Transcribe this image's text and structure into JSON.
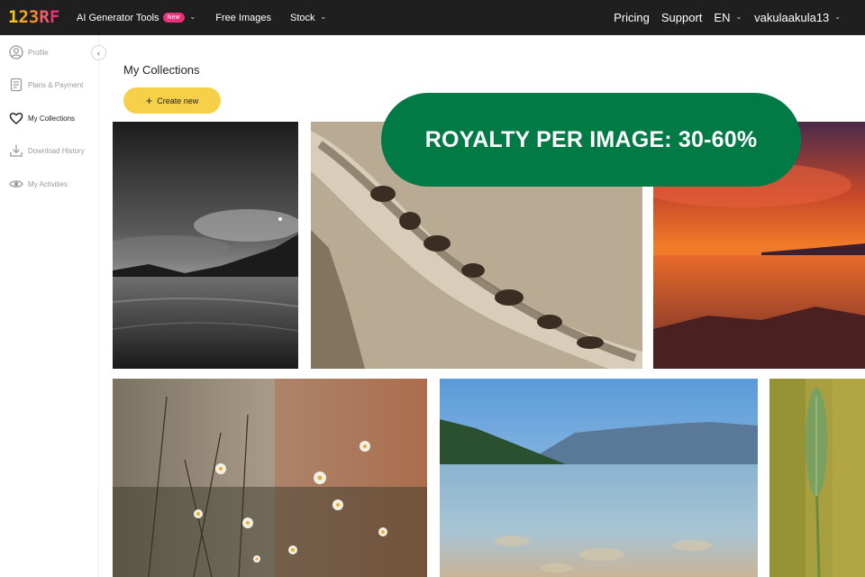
{
  "topbar": {
    "logo_chars": [
      "1",
      "2",
      "3",
      "R",
      "F"
    ],
    "logo_colors": [
      "#f5c518",
      "#f5a623",
      "#f58a2e",
      "#ef5a6f",
      "#e8327c"
    ],
    "nav_left": [
      {
        "label": "AI Generator Tools",
        "badge": "New",
        "has_chevron": true
      },
      {
        "label": "Free Images",
        "has_chevron": false
      },
      {
        "label": "Stock",
        "has_chevron": true
      }
    ],
    "nav_right": {
      "pricing": "Pricing",
      "support": "Support",
      "language": "EN",
      "username": "vakulaakula13"
    }
  },
  "sidebar": {
    "items": [
      {
        "label": "Profile",
        "icon": "user-circle-icon",
        "active": false
      },
      {
        "label": "Plans & Payment",
        "icon": "document-list-icon",
        "active": false
      },
      {
        "label": "My Collections",
        "icon": "heart-icon",
        "active": true
      },
      {
        "label": "Download History",
        "icon": "download-icon",
        "active": false
      },
      {
        "label": "My Activities",
        "icon": "eye-icon",
        "active": false
      }
    ]
  },
  "main": {
    "title": "My Collections",
    "create_button": "Create new",
    "photos": [
      {
        "subject": "dark beach at dusk"
      },
      {
        "subject": "driftwood on sand"
      },
      {
        "subject": "orange sunset over water"
      },
      {
        "subject": "wild daisies in field"
      },
      {
        "subject": "mountain lake shore"
      },
      {
        "subject": "grass seed head"
      }
    ]
  },
  "promo": {
    "text": "ROYALTY PER IMAGE: 30-60%",
    "color": "#027a46"
  },
  "colors": {
    "accent_yellow": "#f7d04a",
    "topbar_bg": "#1f1f1f",
    "new_badge": "#e8327c"
  }
}
